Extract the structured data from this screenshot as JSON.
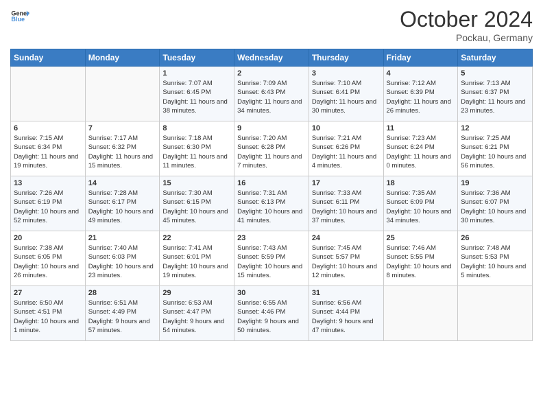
{
  "header": {
    "logo_line1": "General",
    "logo_line2": "Blue",
    "month_title": "October 2024",
    "location": "Pockau, Germany"
  },
  "days_of_week": [
    "Sunday",
    "Monday",
    "Tuesday",
    "Wednesday",
    "Thursday",
    "Friday",
    "Saturday"
  ],
  "weeks": [
    [
      {
        "day": "",
        "sunrise": "",
        "sunset": "",
        "daylight": ""
      },
      {
        "day": "",
        "sunrise": "",
        "sunset": "",
        "daylight": ""
      },
      {
        "day": "1",
        "sunrise": "Sunrise: 7:07 AM",
        "sunset": "Sunset: 6:45 PM",
        "daylight": "Daylight: 11 hours and 38 minutes."
      },
      {
        "day": "2",
        "sunrise": "Sunrise: 7:09 AM",
        "sunset": "Sunset: 6:43 PM",
        "daylight": "Daylight: 11 hours and 34 minutes."
      },
      {
        "day": "3",
        "sunrise": "Sunrise: 7:10 AM",
        "sunset": "Sunset: 6:41 PM",
        "daylight": "Daylight: 11 hours and 30 minutes."
      },
      {
        "day": "4",
        "sunrise": "Sunrise: 7:12 AM",
        "sunset": "Sunset: 6:39 PM",
        "daylight": "Daylight: 11 hours and 26 minutes."
      },
      {
        "day": "5",
        "sunrise": "Sunrise: 7:13 AM",
        "sunset": "Sunset: 6:37 PM",
        "daylight": "Daylight: 11 hours and 23 minutes."
      }
    ],
    [
      {
        "day": "6",
        "sunrise": "Sunrise: 7:15 AM",
        "sunset": "Sunset: 6:34 PM",
        "daylight": "Daylight: 11 hours and 19 minutes."
      },
      {
        "day": "7",
        "sunrise": "Sunrise: 7:17 AM",
        "sunset": "Sunset: 6:32 PM",
        "daylight": "Daylight: 11 hours and 15 minutes."
      },
      {
        "day": "8",
        "sunrise": "Sunrise: 7:18 AM",
        "sunset": "Sunset: 6:30 PM",
        "daylight": "Daylight: 11 hours and 11 minutes."
      },
      {
        "day": "9",
        "sunrise": "Sunrise: 7:20 AM",
        "sunset": "Sunset: 6:28 PM",
        "daylight": "Daylight: 11 hours and 7 minutes."
      },
      {
        "day": "10",
        "sunrise": "Sunrise: 7:21 AM",
        "sunset": "Sunset: 6:26 PM",
        "daylight": "Daylight: 11 hours and 4 minutes."
      },
      {
        "day": "11",
        "sunrise": "Sunrise: 7:23 AM",
        "sunset": "Sunset: 6:24 PM",
        "daylight": "Daylight: 11 hours and 0 minutes."
      },
      {
        "day": "12",
        "sunrise": "Sunrise: 7:25 AM",
        "sunset": "Sunset: 6:21 PM",
        "daylight": "Daylight: 10 hours and 56 minutes."
      }
    ],
    [
      {
        "day": "13",
        "sunrise": "Sunrise: 7:26 AM",
        "sunset": "Sunset: 6:19 PM",
        "daylight": "Daylight: 10 hours and 52 minutes."
      },
      {
        "day": "14",
        "sunrise": "Sunrise: 7:28 AM",
        "sunset": "Sunset: 6:17 PM",
        "daylight": "Daylight: 10 hours and 49 minutes."
      },
      {
        "day": "15",
        "sunrise": "Sunrise: 7:30 AM",
        "sunset": "Sunset: 6:15 PM",
        "daylight": "Daylight: 10 hours and 45 minutes."
      },
      {
        "day": "16",
        "sunrise": "Sunrise: 7:31 AM",
        "sunset": "Sunset: 6:13 PM",
        "daylight": "Daylight: 10 hours and 41 minutes."
      },
      {
        "day": "17",
        "sunrise": "Sunrise: 7:33 AM",
        "sunset": "Sunset: 6:11 PM",
        "daylight": "Daylight: 10 hours and 37 minutes."
      },
      {
        "day": "18",
        "sunrise": "Sunrise: 7:35 AM",
        "sunset": "Sunset: 6:09 PM",
        "daylight": "Daylight: 10 hours and 34 minutes."
      },
      {
        "day": "19",
        "sunrise": "Sunrise: 7:36 AM",
        "sunset": "Sunset: 6:07 PM",
        "daylight": "Daylight: 10 hours and 30 minutes."
      }
    ],
    [
      {
        "day": "20",
        "sunrise": "Sunrise: 7:38 AM",
        "sunset": "Sunset: 6:05 PM",
        "daylight": "Daylight: 10 hours and 26 minutes."
      },
      {
        "day": "21",
        "sunrise": "Sunrise: 7:40 AM",
        "sunset": "Sunset: 6:03 PM",
        "daylight": "Daylight: 10 hours and 23 minutes."
      },
      {
        "day": "22",
        "sunrise": "Sunrise: 7:41 AM",
        "sunset": "Sunset: 6:01 PM",
        "daylight": "Daylight: 10 hours and 19 minutes."
      },
      {
        "day": "23",
        "sunrise": "Sunrise: 7:43 AM",
        "sunset": "Sunset: 5:59 PM",
        "daylight": "Daylight: 10 hours and 15 minutes."
      },
      {
        "day": "24",
        "sunrise": "Sunrise: 7:45 AM",
        "sunset": "Sunset: 5:57 PM",
        "daylight": "Daylight: 10 hours and 12 minutes."
      },
      {
        "day": "25",
        "sunrise": "Sunrise: 7:46 AM",
        "sunset": "Sunset: 5:55 PM",
        "daylight": "Daylight: 10 hours and 8 minutes."
      },
      {
        "day": "26",
        "sunrise": "Sunrise: 7:48 AM",
        "sunset": "Sunset: 5:53 PM",
        "daylight": "Daylight: 10 hours and 5 minutes."
      }
    ],
    [
      {
        "day": "27",
        "sunrise": "Sunrise: 6:50 AM",
        "sunset": "Sunset: 4:51 PM",
        "daylight": "Daylight: 10 hours and 1 minute."
      },
      {
        "day": "28",
        "sunrise": "Sunrise: 6:51 AM",
        "sunset": "Sunset: 4:49 PM",
        "daylight": "Daylight: 9 hours and 57 minutes."
      },
      {
        "day": "29",
        "sunrise": "Sunrise: 6:53 AM",
        "sunset": "Sunset: 4:47 PM",
        "daylight": "Daylight: 9 hours and 54 minutes."
      },
      {
        "day": "30",
        "sunrise": "Sunrise: 6:55 AM",
        "sunset": "Sunset: 4:46 PM",
        "daylight": "Daylight: 9 hours and 50 minutes."
      },
      {
        "day": "31",
        "sunrise": "Sunrise: 6:56 AM",
        "sunset": "Sunset: 4:44 PM",
        "daylight": "Daylight: 9 hours and 47 minutes."
      },
      {
        "day": "",
        "sunrise": "",
        "sunset": "",
        "daylight": ""
      },
      {
        "day": "",
        "sunrise": "",
        "sunset": "",
        "daylight": ""
      }
    ]
  ]
}
